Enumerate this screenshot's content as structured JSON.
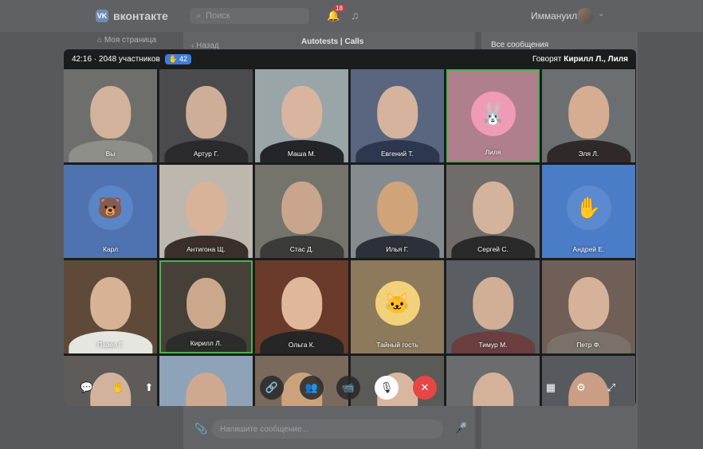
{
  "vk": {
    "logo_mark": "VK",
    "logo_text": "вконтакте",
    "search_placeholder": "Поиск",
    "notifications_count": "18",
    "user_name": "Иммануил",
    "my_page": "Моя страница",
    "back": "Назад",
    "chat_title": "Autotests | Calls",
    "all_messages": "Все сообщения",
    "message_placeholder": "Напишите сообщение..."
  },
  "call": {
    "status": "42:16 · 2048 участников",
    "raised_hands": "42",
    "speaking_prefix": "Говорят",
    "speaking_names": "Кирилл Л., Лиля"
  },
  "participants": [
    {
      "name": "Вы",
      "kind": "photo",
      "bg": "#6e6f6c",
      "skin": "#d2b29a",
      "shirt": "#8d8f88",
      "active": false
    },
    {
      "name": "Артур Г.",
      "kind": "photo",
      "bg": "#4b4b4e",
      "skin": "#cfae98",
      "shirt": "#2b2b2d",
      "active": false
    },
    {
      "name": "Маша М.",
      "kind": "photo",
      "bg": "#9aa5a7",
      "skin": "#d9b59f",
      "shirt": "#23252a",
      "active": false
    },
    {
      "name": "Евгений Т.",
      "kind": "photo",
      "bg": "#5a6680",
      "skin": "#d5b39c",
      "shirt": "#2d3850",
      "active": false
    },
    {
      "name": "Лиля",
      "kind": "avatar",
      "bg": "#b07f8e",
      "circle": "#ef9bb6",
      "glyph": "🐰",
      "active": true
    },
    {
      "name": "Эля Л.",
      "kind": "photo",
      "bg": "#6c6f72",
      "skin": "#d6ad92",
      "shirt": "#2f2a29",
      "active": false
    },
    {
      "name": "Карл",
      "kind": "avatar",
      "bg": "#4f73b0",
      "circle": "#5a86c8",
      "glyph": "🐻",
      "active": false
    },
    {
      "name": "Антигона Щ.",
      "kind": "photo",
      "bg": "#bdb7ad",
      "skin": "#d8b39a",
      "shirt": "#3a2f2a",
      "active": false
    },
    {
      "name": "Стас Д.",
      "kind": "photo",
      "bg": "#74746d",
      "skin": "#c9a58d",
      "shirt": "#3b3c39",
      "active": false
    },
    {
      "name": "Илья Г.",
      "kind": "photo",
      "bg": "#868b90",
      "skin": "#d0a478",
      "shirt": "#2c3038",
      "active": false
    },
    {
      "name": "Сергей С.",
      "kind": "photo",
      "bg": "#706c69",
      "skin": "#d3b39c",
      "shirt": "#2a2a2b",
      "active": false
    },
    {
      "name": "Андрей Е.",
      "kind": "avatar",
      "bg": "#4a7cc7",
      "circle": "#5b8ad1",
      "glyph": "✋",
      "active": false
    },
    {
      "name": "Павел Г.",
      "kind": "photo",
      "bg": "#5f4a3a",
      "skin": "#d7b295",
      "shirt": "#e6e6e0",
      "active": false
    },
    {
      "name": "Кирилл Л.",
      "kind": "photo",
      "bg": "#454038",
      "skin": "#cba88c",
      "shirt": "#2c2c2a",
      "active": true
    },
    {
      "name": "Ольга К.",
      "kind": "photo",
      "bg": "#6a3b2b",
      "skin": "#e0b79b",
      "shirt": "#262626",
      "active": false
    },
    {
      "name": "Тайный гость",
      "kind": "avatar",
      "bg": "#8d7a5c",
      "circle": "#f1d27a",
      "glyph": "🐱",
      "active": false
    },
    {
      "name": "Тимур М.",
      "kind": "photo",
      "bg": "#5a5e62",
      "skin": "#d1ae96",
      "shirt": "#6b3f3f",
      "active": false
    },
    {
      "name": "Петр Ф.",
      "kind": "photo",
      "bg": "#705f56",
      "skin": "#d6b29b",
      "shirt": "#7a7268",
      "active": false
    },
    {
      "name": "",
      "kind": "photo",
      "bg": "#5e5b58",
      "skin": "#d2b29c",
      "shirt": "#333",
      "active": false
    },
    {
      "name": "",
      "kind": "photo",
      "bg": "#8fa3b8",
      "skin": "#cfa98f",
      "shirt": "#2c2c2c",
      "active": false
    },
    {
      "name": "",
      "kind": "photo",
      "bg": "#7a6a5c",
      "skin": "#caa27c",
      "shirt": "#b79568",
      "active": false
    },
    {
      "name": "",
      "kind": "photo",
      "bg": "#5a5a57",
      "skin": "#d8b7a0",
      "shirt": "#3d3d3d",
      "active": false
    },
    {
      "name": "",
      "kind": "photo",
      "bg": "#6a6c6e",
      "skin": "#d4b29a",
      "shirt": "#2e2e30",
      "active": false
    },
    {
      "name": "",
      "kind": "photo",
      "bg": "#565a5e",
      "skin": "#c99e84",
      "shirt": "#1f2b3a",
      "active": false
    }
  ],
  "controls": {
    "chat": "chat-bubble-icon",
    "raise_hand": "raise-hand-icon",
    "share_screen": "share-screen-icon",
    "link": "link-icon",
    "participants": "participants-icon",
    "camera": "camera-icon",
    "mic": "mic-muted-icon",
    "end_call": "end-call-icon",
    "layout": "grid-layout-icon",
    "settings": "gear-icon",
    "fullscreen": "fullscreen-icon"
  }
}
